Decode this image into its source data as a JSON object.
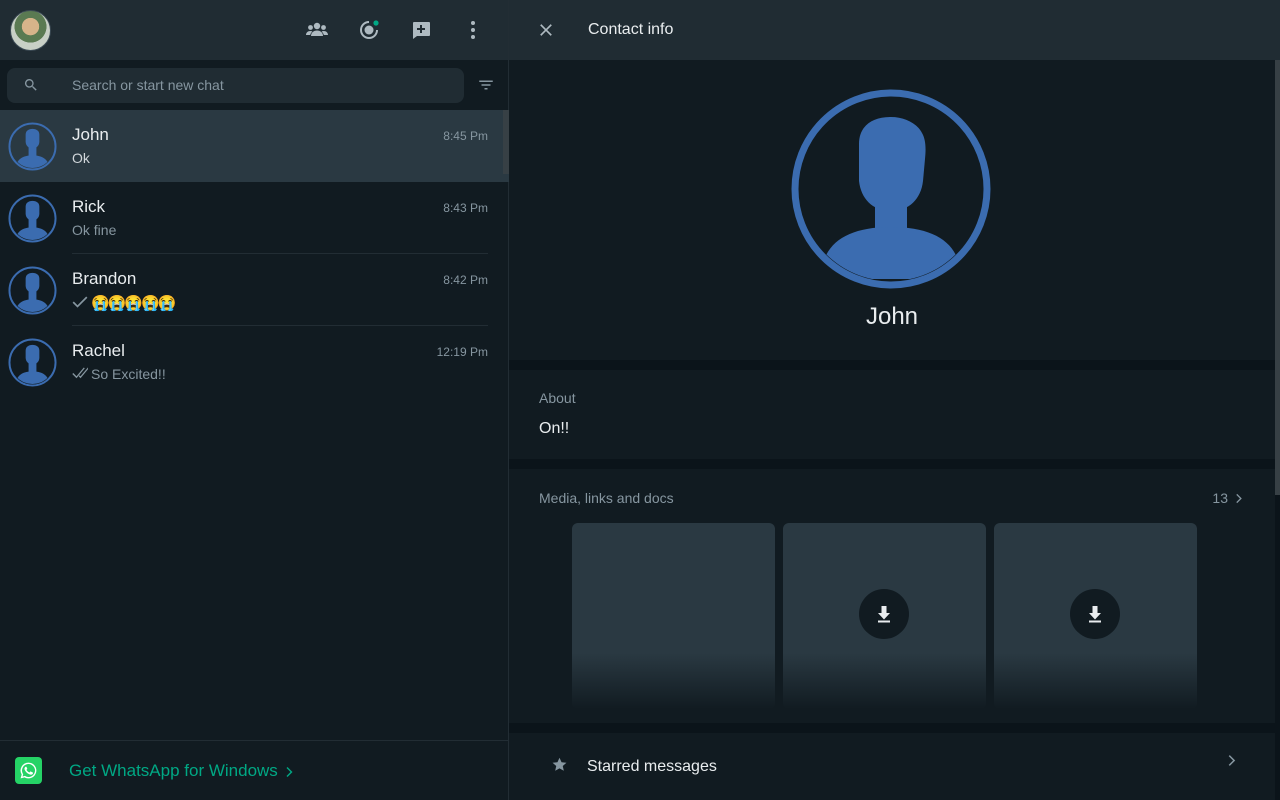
{
  "left_header": {
    "icons": [
      "communities-icon",
      "status-icon",
      "new-chat-icon",
      "menu-icon"
    ]
  },
  "search": {
    "placeholder": "Search or start new chat"
  },
  "chats": [
    {
      "name": "John",
      "time": "8:45 Pm",
      "preview": "Ok",
      "tick": "none",
      "active": true
    },
    {
      "name": "Rick",
      "time": "8:43 Pm",
      "preview": "Ok fine",
      "tick": "none",
      "active": false
    },
    {
      "name": "Brandon",
      "time": "8:42 Pm",
      "preview": "😭😭😭😭😭",
      "tick": "single",
      "active": false
    },
    {
      "name": "Rachel",
      "time": "12:19 Pm",
      "preview": "So Excited!!",
      "tick": "double",
      "active": false
    }
  ],
  "get_app": {
    "label": "Get WhatsApp for Windows"
  },
  "contact_info": {
    "title": "Contact info",
    "name": "John",
    "about_label": "About",
    "about_value": "On!!",
    "media_label": "Media, links and docs",
    "media_count": "13",
    "starred_label": "Starred messages"
  },
  "colors": {
    "accent": "#00a884",
    "avatar_blue": "#3b6cb0",
    "panel_bg": "#111b21",
    "header_bg": "#202c33"
  }
}
